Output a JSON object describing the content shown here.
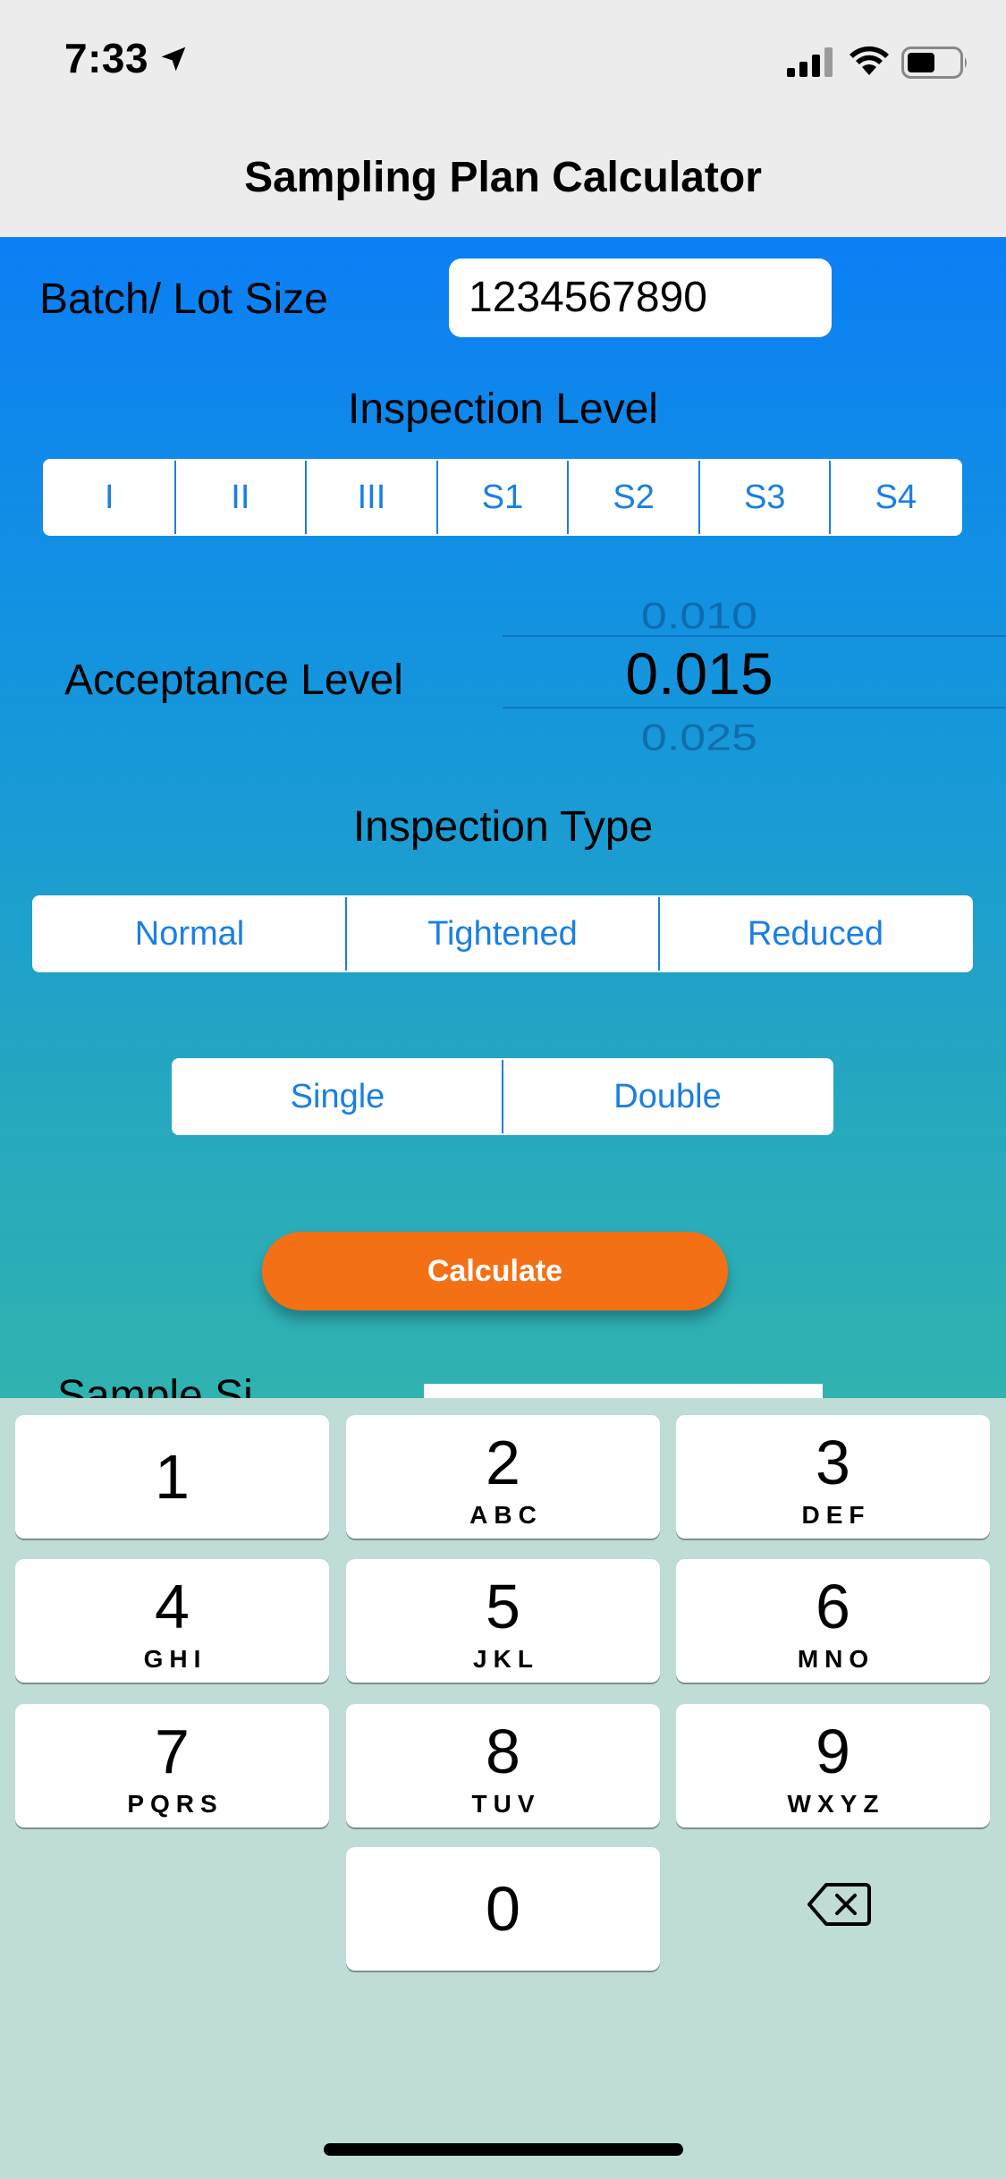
{
  "status": {
    "time": "7:33"
  },
  "nav": {
    "title": "Sampling Plan Calculator"
  },
  "form": {
    "lot_label": "Batch/ Lot Size",
    "lot_value": "1234567890",
    "inspection_level_title": "Inspection Level",
    "inspection_levels": [
      "I",
      "II",
      "III",
      "S1",
      "S2",
      "S3",
      "S4"
    ],
    "acceptance_label": "Acceptance Level",
    "acceptance_picker": {
      "above": "0.010",
      "selected": "0.015",
      "below": "0.025"
    },
    "inspection_type_title": "Inspection Type",
    "inspection_types": [
      "Normal",
      "Tightened",
      "Reduced"
    ],
    "plan_types": [
      "Single",
      "Double"
    ],
    "calculate_label": "Calculate",
    "sample_label": "Sample Si"
  },
  "keypad": {
    "keys": [
      {
        "num": "1",
        "letters": ""
      },
      {
        "num": "2",
        "letters": "ABC"
      },
      {
        "num": "3",
        "letters": "DEF"
      },
      {
        "num": "4",
        "letters": "GHI"
      },
      {
        "num": "5",
        "letters": "JKL"
      },
      {
        "num": "6",
        "letters": "MNO"
      },
      {
        "num": "7",
        "letters": "PQRS"
      },
      {
        "num": "8",
        "letters": "TUV"
      },
      {
        "num": "9",
        "letters": "WXYZ"
      },
      {
        "num": "0",
        "letters": ""
      }
    ]
  },
  "colors": {
    "accent": "#1a7fe3",
    "button": "#f47015",
    "gradient_top": "#0b7ff5",
    "gradient_bottom": "#30b2b0"
  },
  "icons": [
    "location-arrow-icon",
    "signal-icon",
    "wifi-icon",
    "battery-icon",
    "backspace-icon"
  ]
}
